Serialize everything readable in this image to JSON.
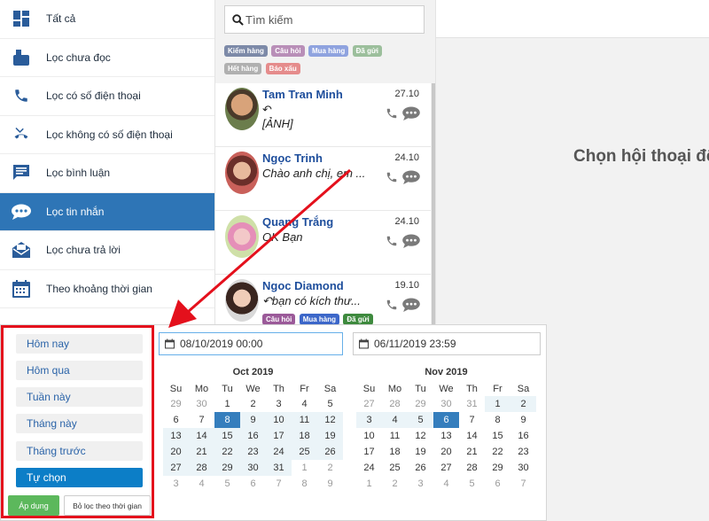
{
  "sidebar": {
    "items": [
      {
        "label": "Tất cả",
        "icon": "dashboard-icon",
        "active": false
      },
      {
        "label": "Lọc chưa đọc",
        "icon": "unread-icon",
        "active": false
      },
      {
        "label": "Lọc có số điện thoại",
        "icon": "phone-icon",
        "active": false
      },
      {
        "label": "Lọc không có số điện thoại",
        "icon": "phone-missed-icon",
        "active": false
      },
      {
        "label": "Lọc bình luận",
        "icon": "comment-icon",
        "active": false
      },
      {
        "label": "Lọc tin nhắn",
        "icon": "chat-bubble-icon",
        "active": true
      },
      {
        "label": "Lọc chưa trả lời",
        "icon": "mail-open-icon",
        "active": false
      },
      {
        "label": "Theo khoảng thời gian",
        "icon": "calendar-icon",
        "active": false
      }
    ]
  },
  "search": {
    "placeholder": "Tìm kiếm"
  },
  "tags": [
    {
      "label": "Kiểm hàng",
      "color": "#7d8aa8"
    },
    {
      "label": "Câu hỏi",
      "color": "#b98fb8"
    },
    {
      "label": "Mua hàng",
      "color": "#8fa3df"
    },
    {
      "label": "Đã gửi",
      "color": "#9cbf9c"
    },
    {
      "label": "Hết hàng",
      "color": "#b0b0b0"
    },
    {
      "label": "Báo xấu",
      "color": "#e58c8c"
    }
  ],
  "conversations": [
    {
      "name": "Tam Tran Minh",
      "date": "27.10",
      "reply_glyph": "↶",
      "preview": "[ẢNH]"
    },
    {
      "name": "Ngọc Trinh",
      "date": "24.10",
      "preview": "Chào anh chị, em ..."
    },
    {
      "name": "Quang Trắng",
      "date": "24.10",
      "preview": "OK Bạn"
    },
    {
      "name": "Ngoc Diamond",
      "date": "19.10",
      "preview": "↶bạn có kích thư...",
      "tags": [
        {
          "label": "Câu hỏi",
          "color": "#9b5a99"
        },
        {
          "label": "Mua hàng",
          "color": "#3c67c9"
        },
        {
          "label": "Đã gửi",
          "color": "#3e8a3e"
        }
      ]
    }
  ],
  "main": {
    "prompt": "Chọn hội thoại để"
  },
  "date_filter": {
    "ranges": [
      {
        "label": "Hôm nay",
        "active": false
      },
      {
        "label": "Hôm qua",
        "active": false
      },
      {
        "label": "Tuần này",
        "active": false
      },
      {
        "label": "Tháng này",
        "active": false
      },
      {
        "label": "Tháng trước",
        "active": false
      },
      {
        "label": "Tự chọn",
        "active": true
      }
    ],
    "apply_label": "Áp dụng",
    "clear_label": "Bỏ lọc theo thời gian",
    "start_value": "08/10/2019 00:00",
    "end_value": "06/11/2019 23:59",
    "weekdays": [
      "Su",
      "Mo",
      "Tu",
      "We",
      "Th",
      "Fr",
      "Sa"
    ],
    "calendars": [
      {
        "month": "Oct 2019",
        "weeks": [
          [
            [
              "29",
              "off"
            ],
            [
              "30",
              "off"
            ],
            [
              "1",
              ""
            ],
            [
              "2",
              ""
            ],
            [
              "3",
              ""
            ],
            [
              "4",
              ""
            ],
            [
              "5",
              ""
            ]
          ],
          [
            [
              "6",
              ""
            ],
            [
              "7",
              ""
            ],
            [
              "8",
              "sel"
            ],
            [
              "9",
              "in"
            ],
            [
              "10",
              "in"
            ],
            [
              "11",
              "in"
            ],
            [
              "12",
              "in"
            ]
          ],
          [
            [
              "13",
              "in"
            ],
            [
              "14",
              "in"
            ],
            [
              "15",
              "in"
            ],
            [
              "16",
              "in"
            ],
            [
              "17",
              "in"
            ],
            [
              "18",
              "in"
            ],
            [
              "19",
              "in"
            ]
          ],
          [
            [
              "20",
              "in"
            ],
            [
              "21",
              "in"
            ],
            [
              "22",
              "in"
            ],
            [
              "23",
              "in"
            ],
            [
              "24",
              "in"
            ],
            [
              "25",
              "in"
            ],
            [
              "26",
              "in"
            ]
          ],
          [
            [
              "27",
              "in"
            ],
            [
              "28",
              "in"
            ],
            [
              "29",
              "in"
            ],
            [
              "30",
              "in"
            ],
            [
              "31",
              "in"
            ],
            [
              "1",
              "off"
            ],
            [
              "2",
              "off"
            ]
          ],
          [
            [
              "3",
              "off"
            ],
            [
              "4",
              "off"
            ],
            [
              "5",
              "off"
            ],
            [
              "6",
              "off"
            ],
            [
              "7",
              "off"
            ],
            [
              "8",
              "off"
            ],
            [
              "9",
              "off"
            ]
          ]
        ]
      },
      {
        "month": "Nov 2019",
        "weeks": [
          [
            [
              "27",
              "off"
            ],
            [
              "28",
              "off"
            ],
            [
              "29",
              "off"
            ],
            [
              "30",
              "off"
            ],
            [
              "31",
              "off"
            ],
            [
              "1",
              "in"
            ],
            [
              "2",
              "in"
            ]
          ],
          [
            [
              "3",
              "in"
            ],
            [
              "4",
              "in"
            ],
            [
              "5",
              "in"
            ],
            [
              "6",
              "sel"
            ],
            [
              "7",
              ""
            ],
            [
              "8",
              ""
            ],
            [
              "9",
              ""
            ]
          ],
          [
            [
              "10",
              ""
            ],
            [
              "11",
              ""
            ],
            [
              "12",
              ""
            ],
            [
              "13",
              ""
            ],
            [
              "14",
              ""
            ],
            [
              "15",
              ""
            ],
            [
              "16",
              ""
            ]
          ],
          [
            [
              "17",
              ""
            ],
            [
              "18",
              ""
            ],
            [
              "19",
              ""
            ],
            [
              "20",
              ""
            ],
            [
              "21",
              ""
            ],
            [
              "22",
              ""
            ],
            [
              "23",
              ""
            ]
          ],
          [
            [
              "24",
              ""
            ],
            [
              "25",
              ""
            ],
            [
              "26",
              ""
            ],
            [
              "27",
              ""
            ],
            [
              "28",
              ""
            ],
            [
              "29",
              ""
            ],
            [
              "30",
              ""
            ]
          ],
          [
            [
              "1",
              "off"
            ],
            [
              "2",
              "off"
            ],
            [
              "3",
              "off"
            ],
            [
              "4",
              "off"
            ],
            [
              "5",
              "off"
            ],
            [
              "6",
              "off"
            ],
            [
              "7",
              "off"
            ]
          ]
        ]
      }
    ]
  },
  "colors": {
    "accent": "#2e75b6",
    "highlight": "#e4101c",
    "selected_day": "#357ebd"
  }
}
